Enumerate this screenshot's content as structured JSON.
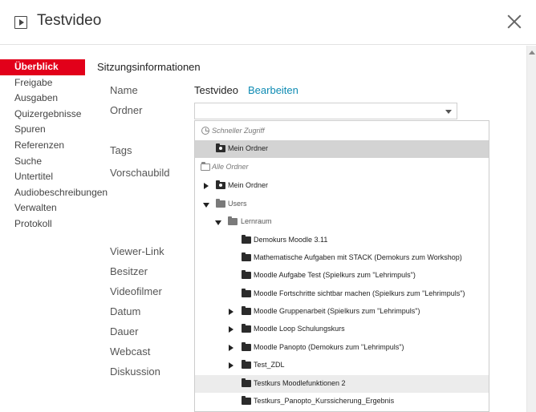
{
  "header": {
    "title": "Testvideo"
  },
  "sidebar": {
    "items": [
      {
        "label": "Überblick"
      },
      {
        "label": "Freigabe"
      },
      {
        "label": "Ausgaben"
      },
      {
        "label": "Quizergebnisse"
      },
      {
        "label": "Spuren"
      },
      {
        "label": "Referenzen"
      },
      {
        "label": "Suche"
      },
      {
        "label": "Untertitel"
      },
      {
        "label": "Audiobeschreibungen"
      },
      {
        "label": "Verwalten"
      },
      {
        "label": "Protokoll"
      }
    ]
  },
  "main": {
    "section_title": "Sitzungsinformationen",
    "fields": {
      "name_label": "Name",
      "name_value": "Testvideo",
      "edit_link": "Bearbeiten",
      "folder_label": "Ordner",
      "tags_label": "Tags",
      "thumbnail_label": "Vorschaubild",
      "viewer_link_label": "Viewer-Link",
      "owner_label": "Besitzer",
      "videographer_label": "Videofilmer",
      "date_label": "Datum",
      "duration_label": "Dauer",
      "webcast_label": "Webcast",
      "discussion_label": "Diskussion"
    }
  },
  "dropdown": {
    "quick_access_header": "Schneller Zugriff",
    "quick_access_item": "Mein Ordner",
    "all_folders_header": "Alle Ordner",
    "tree": [
      {
        "label": "Mein Ordner"
      },
      {
        "label": "Users"
      },
      {
        "label": "Lernraum"
      },
      {
        "label": "Demokurs Moodle 3.11"
      },
      {
        "label": "Mathematische Aufgaben mit STACK (Demokurs zum Workshop)"
      },
      {
        "label": "Moodle Aufgabe Test (Spielkurs zum \"Lehrimpuls\")"
      },
      {
        "label": "Moodle Fortschritte sichtbar machen (Spielkurs zum \"Lehrimpuls\")"
      },
      {
        "label": "Moodle Gruppenarbeit (Spielkurs zum \"Lehrimpuls\")"
      },
      {
        "label": "Moodle Loop Schulungskurs"
      },
      {
        "label": "Moodle Panopto (Demokurs zum \"Lehrimpuls\")"
      },
      {
        "label": "Test_ZDL"
      },
      {
        "label": "Testkurs Moodlefunktionen 2"
      },
      {
        "label": "Testkurs_Panopto_Kurssicherung_Ergebnis"
      }
    ]
  },
  "colors": {
    "accent": "#e2001a",
    "link": "#0e8bb3",
    "selected_row": "#d3d3d3"
  }
}
